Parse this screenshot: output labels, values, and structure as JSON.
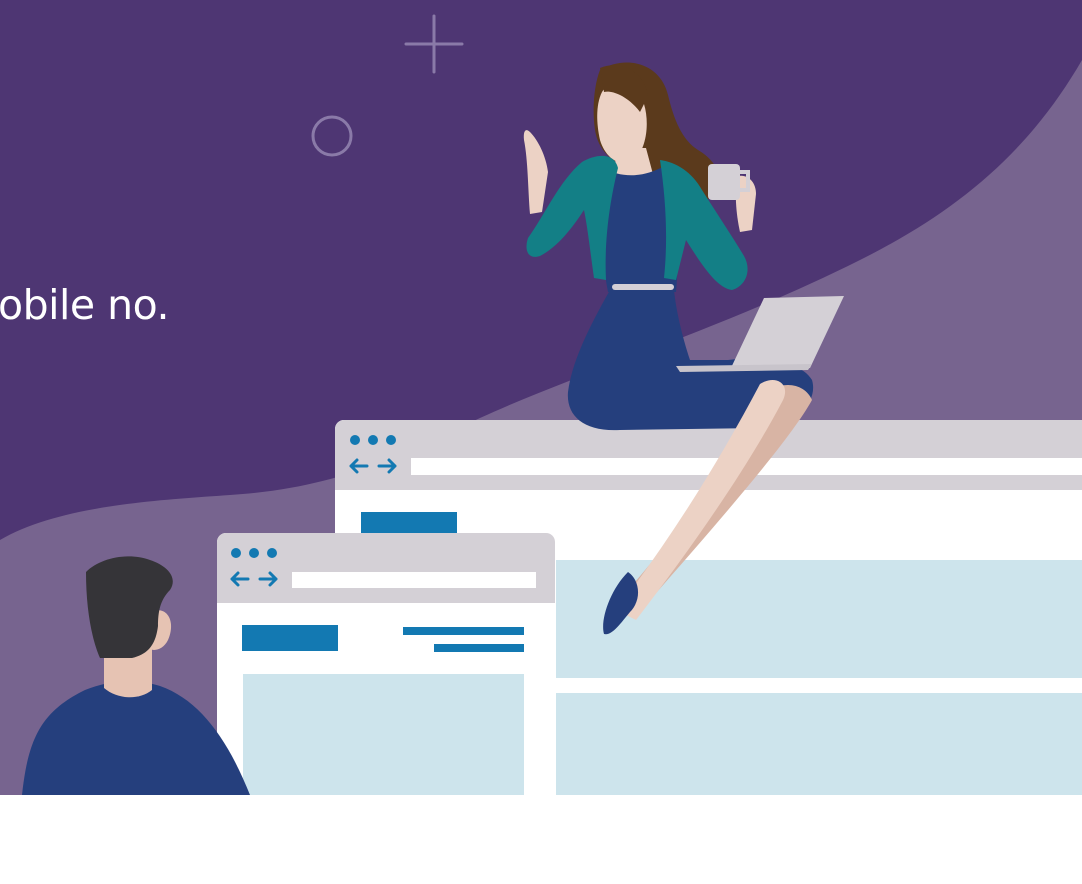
{
  "hero": {
    "headline": "obile no."
  },
  "colors": {
    "background_dark": "#4e3673",
    "background_light": "#77648f",
    "accent_blue": "#1379b2",
    "panel_light": "#cde4ec",
    "browser_chrome": "#d4d0d6"
  },
  "illustration": {
    "decorations": [
      "plus-icon",
      "circle-icon"
    ],
    "browser_windows": 2,
    "people": [
      "woman-with-laptop-and-mug",
      "man-looking-at-screens"
    ]
  }
}
